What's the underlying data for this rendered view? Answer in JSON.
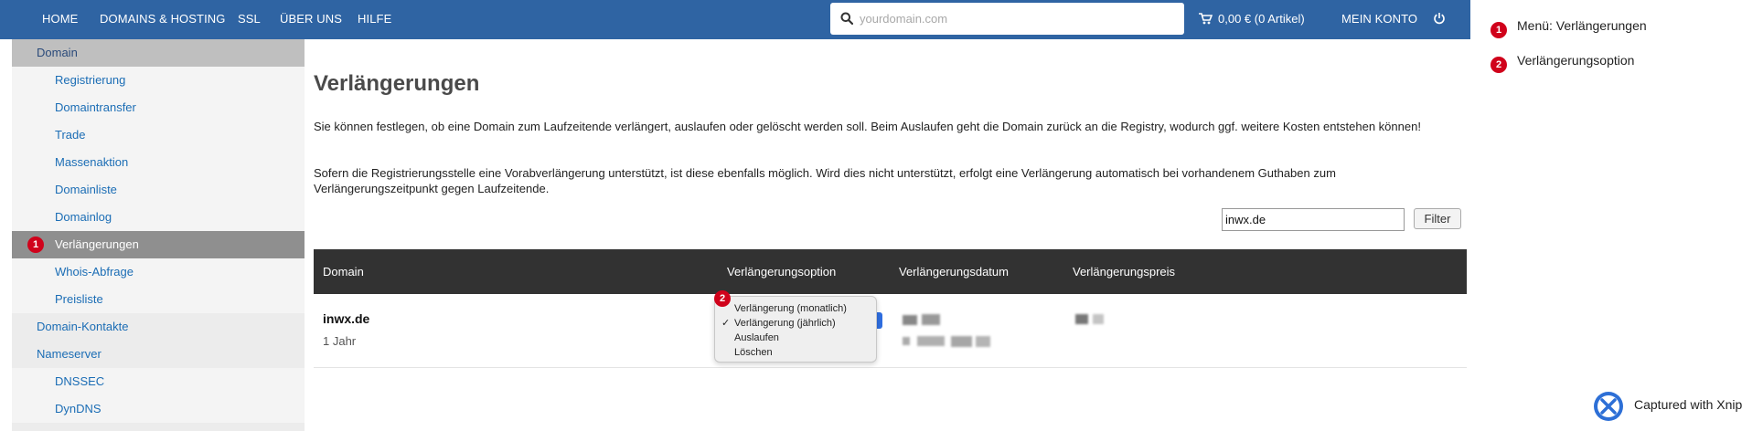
{
  "nav": {
    "items": [
      "HOME",
      "DOMAINS & HOSTING",
      "SSL",
      "ÜBER UNS",
      "HILFE"
    ],
    "search_placeholder": "yourdomain.com",
    "cart": "0,00 € (0 Artikel)",
    "account": "MEIN KONTO"
  },
  "sidebar": {
    "items": [
      {
        "label": "Domain",
        "level": 1,
        "state": "header"
      },
      {
        "label": "Registrierung",
        "level": 2
      },
      {
        "label": "Domaintransfer",
        "level": 2
      },
      {
        "label": "Trade",
        "level": 2
      },
      {
        "label": "Massenaktion",
        "level": 2
      },
      {
        "label": "Domainliste",
        "level": 2
      },
      {
        "label": "Domainlog",
        "level": 2
      },
      {
        "label": "Verlängerungen",
        "level": 2,
        "state": "active"
      },
      {
        "label": "Whois-Abfrage",
        "level": 2
      },
      {
        "label": "Preisliste",
        "level": 2
      },
      {
        "label": "Domain-Kontakte",
        "level": 1
      },
      {
        "label": "Nameserver",
        "level": 1
      },
      {
        "label": "DNSSEC",
        "level": 2
      },
      {
        "label": "DynDNS",
        "level": 2
      }
    ]
  },
  "main": {
    "title": "Verlängerungen",
    "paragraph1": "Sie können festlegen, ob eine Domain zum Laufzeitende verlängert, auslaufen oder gelöscht werden soll. Beim Auslaufen geht die Domain zurück an die Registry, wodurch ggf. weitere Kosten entstehen können!",
    "paragraph2": "Sofern die Registrierungsstelle eine Vorabverlängerung unterstützt, ist diese ebenfalls möglich. Wird dies nicht unterstützt, erfolgt eine Verlängerung automatisch bei vorhandenem Guthaben zum Verlängerungszeitpunkt gegen Laufzeitende.",
    "filter_value": "inwx.de",
    "filter_button": "Filter",
    "table": {
      "headers": [
        "Domain",
        "Verlängerungsoption",
        "Verlängerungsdatum",
        "Verlängerungspreis"
      ],
      "rows": [
        {
          "domain": "inwx.de",
          "term": "1 Jahr"
        }
      ]
    },
    "dropdown": {
      "options": [
        "Verlängerung (monatlich)",
        "Verlängerung (jährlich)",
        "Auslaufen",
        "Löschen"
      ],
      "selected": "Verlängerung (jährlich)",
      "check_mark": "✓"
    }
  },
  "annotations": {
    "badges": [
      "1",
      "2"
    ],
    "legend": [
      {
        "num": "1",
        "label": "Menü: Verlängerungen"
      },
      {
        "num": "2",
        "label": "Verlängerungsoption"
      }
    ],
    "badge_color": "#d0021b"
  },
  "footer": {
    "xnip_label": "Captured with Xnip"
  },
  "colors": {
    "nav_bg": "#2f64a3",
    "link": "#1b6db5",
    "table_header_bg": "#323232",
    "sidebar_active": "#8f8f8f"
  }
}
